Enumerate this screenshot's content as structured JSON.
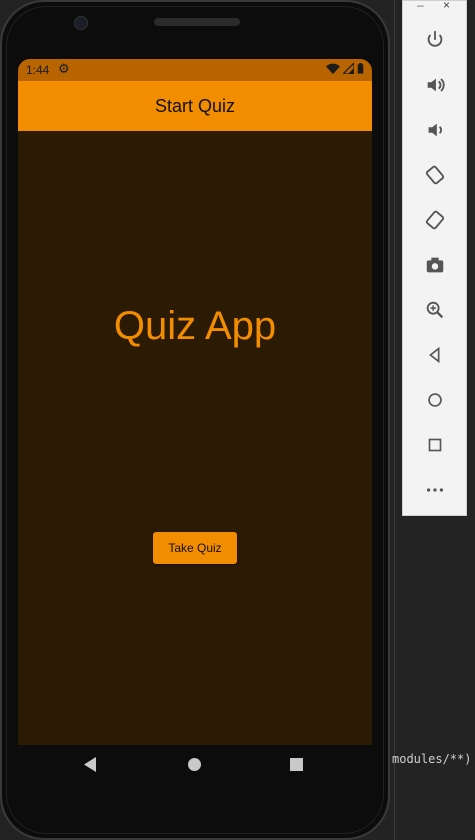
{
  "ide": {
    "path_text": "modules/**)"
  },
  "toolbar": {
    "minimize_label": "–",
    "close_label": "×",
    "buttons": [
      {
        "name": "power-button",
        "icon": "power-icon"
      },
      {
        "name": "volume-up-button",
        "icon": "volume-up-icon"
      },
      {
        "name": "volume-down-button",
        "icon": "volume-down-icon"
      },
      {
        "name": "rotate-left-button",
        "icon": "rotate-left-icon"
      },
      {
        "name": "rotate-right-button",
        "icon": "rotate-right-icon"
      },
      {
        "name": "screenshot-button",
        "icon": "camera-icon"
      },
      {
        "name": "zoom-button",
        "icon": "zoom-icon"
      },
      {
        "name": "back-button",
        "icon": "back-triangle-icon"
      },
      {
        "name": "home-button",
        "icon": "home-circle-icon"
      },
      {
        "name": "overview-button",
        "icon": "overview-square-icon"
      },
      {
        "name": "more-button",
        "icon": "more-dots-icon"
      }
    ]
  },
  "status_bar": {
    "time": "1:44",
    "icons": [
      "gear-icon",
      "wifi-icon",
      "signal-icon",
      "battery-icon"
    ]
  },
  "app_bar": {
    "title": "Start Quiz"
  },
  "main": {
    "headline": "Quiz App",
    "button_label": "Take Quiz"
  },
  "colors": {
    "accent": "#f38d00",
    "status_bar": "#b86400",
    "background": "#2b1a04"
  }
}
